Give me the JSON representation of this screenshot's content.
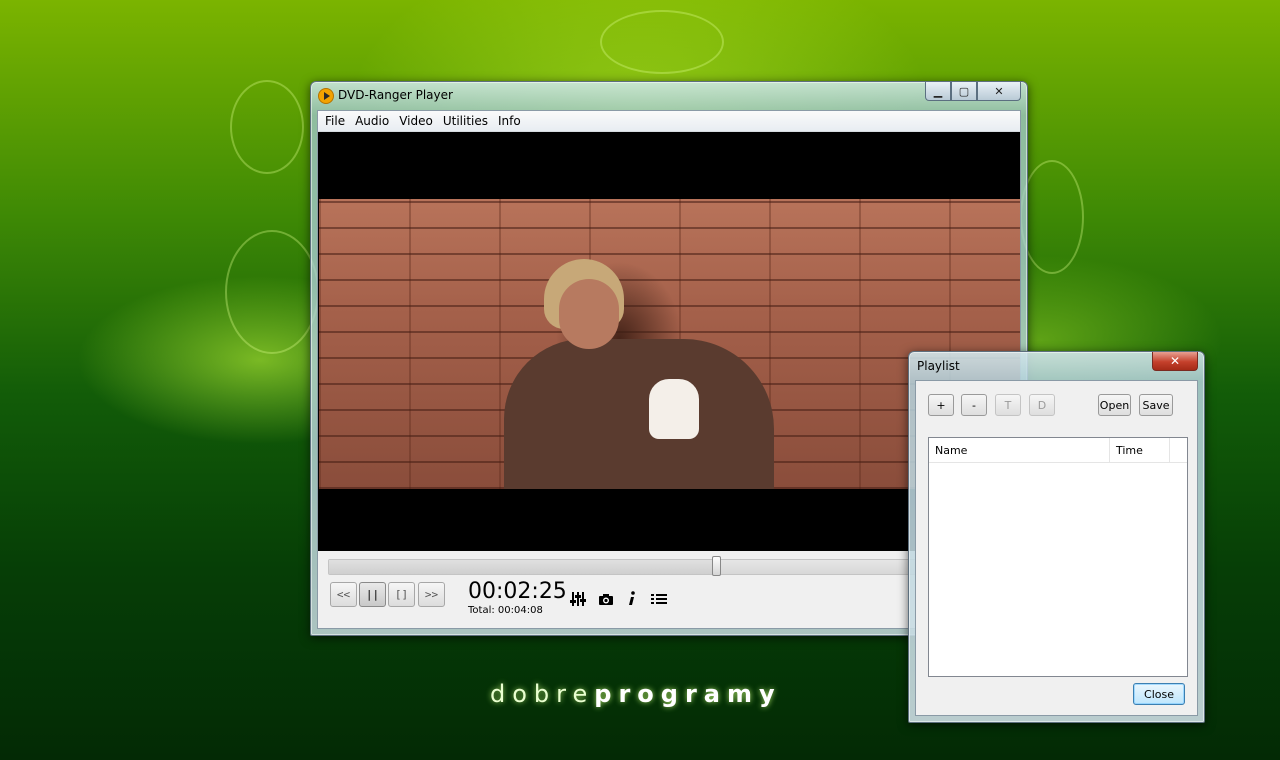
{
  "desktop": {
    "brand_light": "dobre",
    "brand_bold": "programy"
  },
  "player": {
    "title": "DVD-Ranger Player",
    "menu": [
      "File",
      "Audio",
      "Video",
      "Utilities",
      "Info"
    ],
    "caption": {
      "minimize": "▁",
      "maximize": "▢",
      "close": "✕"
    },
    "controls": {
      "prev": "<<",
      "pause": "||",
      "stop": "[]",
      "next": ">>",
      "time": "00:02:25",
      "total": "Total: 00:04:08",
      "seek_fraction": 0.57
    },
    "tool_icons": [
      "equalizer-icon",
      "camera-icon",
      "info-icon",
      "playlist-icon"
    ]
  },
  "playlist": {
    "title": "Playlist",
    "close_glyph": "✕",
    "buttons": {
      "add": "+",
      "remove": "-",
      "t": "T",
      "d": "D",
      "open": "Open",
      "save": "Save"
    },
    "columns": [
      "Name",
      "Time"
    ],
    "close_label": "Close"
  }
}
